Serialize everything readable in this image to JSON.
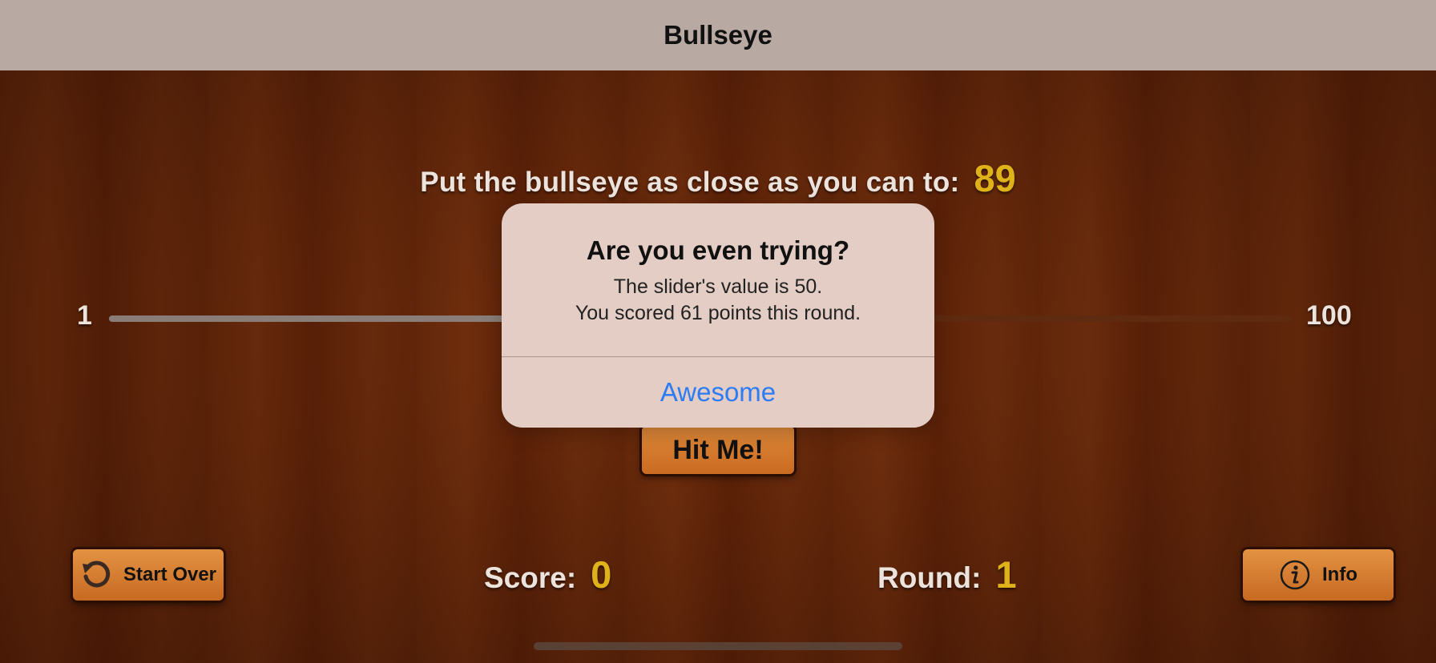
{
  "nav": {
    "title": "Bullseye"
  },
  "game": {
    "target_label": "Put the bullseye as close as you can to:",
    "target_value": "89",
    "slider": {
      "min_label": "1",
      "max_label": "100",
      "value": 50,
      "min": 1,
      "max": 100
    },
    "hit_button": "Hit Me!",
    "start_over_button": "Start Over",
    "info_button": "Info",
    "score_label": "Score:",
    "score_value": "0",
    "round_label": "Round:",
    "round_value": "1"
  },
  "alert": {
    "title": "Are you even trying?",
    "message_line1": "The slider's value is 50.",
    "message_line2": "You scored 61 points this round.",
    "action": "Awesome"
  },
  "colors": {
    "accent_gold": "#e0b21a",
    "button_orange": "#d77a2e",
    "alert_action_blue": "#2c7cf6"
  },
  "icons": {
    "start_over": "rotate-counterclockwise-icon",
    "info": "info-circle-icon"
  }
}
